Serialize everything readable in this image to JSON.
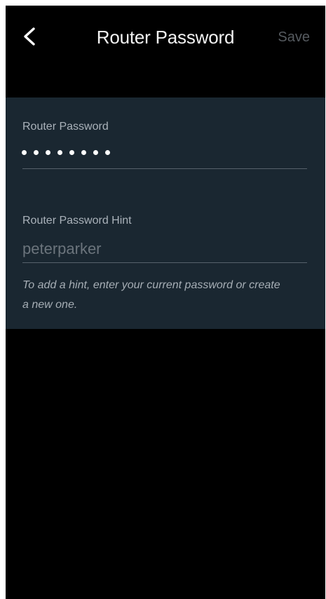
{
  "header": {
    "back_icon": "chevron-left-icon",
    "title": "Router Password",
    "save_label": "Save"
  },
  "form": {
    "password_label": "Router Password",
    "password_masked_length": 8,
    "hint_label": "Router Password Hint",
    "hint_placeholder": "peterparker",
    "hint_value": "",
    "helper_text": "To add a hint, enter your current password or create a new one."
  },
  "colors": {
    "background": "#000000",
    "panel": "#1a2731",
    "save_disabled": "#565b60"
  }
}
